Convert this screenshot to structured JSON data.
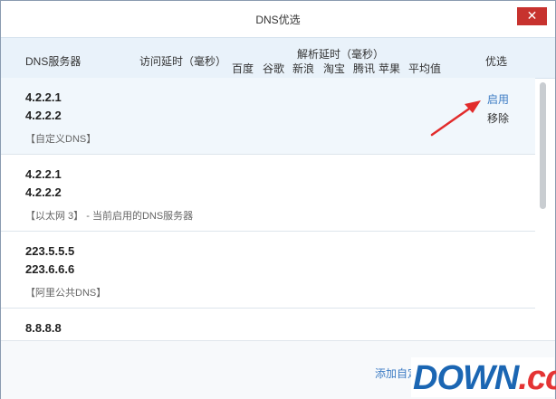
{
  "window": {
    "title": "DNS优选",
    "close_glyph": "✕"
  },
  "columns": {
    "dns_server": "DNS服务器",
    "latency": "访问延时（毫秒）",
    "resolve_group": "解析延时（毫秒）",
    "baidu": "百度",
    "google": "谷歌",
    "sina": "新浪",
    "taobao": "淘宝",
    "tencent": "腾讯",
    "apple": "苹果",
    "average": "平均值",
    "optimize": "优选"
  },
  "rows": [
    {
      "ip1": "4.2.2.1",
      "ip2": "4.2.2.2",
      "note": "【自定义DNS】",
      "actions": {
        "enable": "启用",
        "remove": "移除"
      }
    },
    {
      "ip1": "4.2.2.1",
      "ip2": "4.2.2.2",
      "note": "【以太网 3】 - 当前启用的DNS服务器"
    },
    {
      "ip1": "223.5.5.5",
      "ip2": "223.6.6.6",
      "note": "【阿里公共DNS】"
    },
    {
      "ip1": "8.8.8.8"
    }
  ],
  "footer": {
    "add_link": "添加自定"
  },
  "watermark": {
    "text": "DOWN",
    "suffix": ".cc"
  },
  "colors": {
    "accent": "#3d7cc4",
    "close": "#c7322e",
    "header_bg": "#e9f2fa",
    "arrow": "#e22b2b"
  }
}
